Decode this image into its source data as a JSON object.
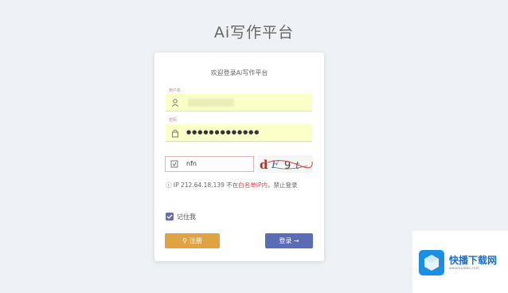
{
  "page": {
    "title": "Ai写作平台"
  },
  "card": {
    "title": "欢迎登录Ai写作平台",
    "username": {
      "label": "用户名",
      "value": ""
    },
    "password": {
      "label": "密码",
      "value": "●●●●●●●●●●●●●"
    },
    "captcha": {
      "value": "nfn",
      "image_text": "dF9t"
    },
    "ip_notice": {
      "prefix": "IP 212.64.18.139 不在",
      "warn": "白名单IP内",
      "suffix": "，禁止登录"
    },
    "remember_label": "记住我",
    "register_label": "注册",
    "login_label": "登录 →"
  },
  "watermark": {
    "title": "快播下载网",
    "subtitle": "www.kuaibo.com"
  },
  "colors": {
    "register": "#e0a343",
    "login": "#5c6bb5",
    "input_bg": "#fbffc8",
    "warn": "#d04545"
  }
}
